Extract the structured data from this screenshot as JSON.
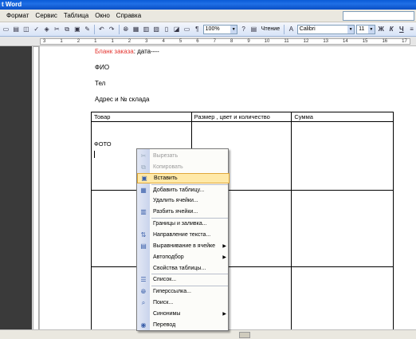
{
  "title": "t Word",
  "menu": [
    {
      "label": "Формат",
      "key": "Ф"
    },
    {
      "label": "Сервис",
      "key": "С"
    },
    {
      "label": "Таблица",
      "key": "Т"
    },
    {
      "label": "Окно",
      "key": "О"
    },
    {
      "label": "Справка",
      "key": "С"
    }
  ],
  "toolbar": {
    "zoom": "100%",
    "reading": "Чтение",
    "font": "Calibri",
    "size": "11",
    "bold": "Ж",
    "italic": "К",
    "underline": "Ч"
  },
  "ruler_numbers": [
    "3",
    "1",
    "2",
    "1",
    "1",
    "2",
    "3",
    "4",
    "5",
    "6",
    "7",
    "8",
    "9",
    "10",
    "11",
    "12",
    "13",
    "14",
    "15",
    "16",
    "17"
  ],
  "doc": {
    "line1_red": "Бланк заказа",
    "line1_rest": ": дата----",
    "fio": "ФИО",
    "tel": "Тел",
    "address": "Адрес и № склада",
    "table_headers": [
      "Товар",
      "Размер , цвет и количество",
      "Сумма"
    ],
    "photo": "ФОТО"
  },
  "context_menu": [
    {
      "label": "Вырезать",
      "icon": "scissors-icon",
      "disabled": true
    },
    {
      "label": "Копировать",
      "icon": "copy-icon",
      "disabled": true
    },
    {
      "label": "Вставить",
      "icon": "paste-icon",
      "highlighted": true
    },
    {
      "label": "Добавить таблицу...",
      "icon": "insert-table-icon"
    },
    {
      "label": "Удалить ячейки...",
      "icon": ""
    },
    {
      "label": "Разбить ячейки...",
      "icon": "split-cells-icon"
    },
    {
      "label": "Границы и заливка...",
      "icon": ""
    },
    {
      "label": "Направление текста...",
      "icon": "text-direction-icon"
    },
    {
      "label": "Выравнивание в ячейке",
      "icon": "cell-align-icon",
      "submenu": true
    },
    {
      "label": "Автоподбор",
      "icon": "",
      "submenu": true
    },
    {
      "label": "Свойства таблицы...",
      "icon": ""
    },
    {
      "label": "Список...",
      "icon": "bullet-list-icon"
    },
    {
      "label": "Гиперссылка...",
      "icon": "hyperlink-icon"
    },
    {
      "label": "Поиск...",
      "icon": "search-icon"
    },
    {
      "label": "Синонимы",
      "icon": "",
      "submenu": true
    },
    {
      "label": "Перевод",
      "icon": "translate-icon"
    }
  ]
}
